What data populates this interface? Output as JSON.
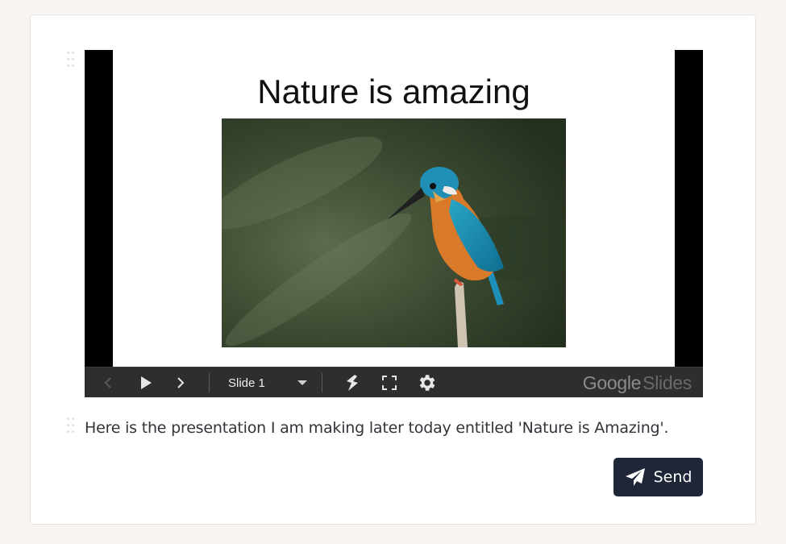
{
  "slide": {
    "title": "Nature is amazing",
    "image_description": "kingfisher-photo"
  },
  "controls": {
    "slide_selector": "Slide 1",
    "brand_google": "Google",
    "brand_slides": "Slides"
  },
  "icons": {
    "prev": "chevron-left-icon",
    "play": "play-icon",
    "next": "chevron-right-icon",
    "laser": "laser-pointer-icon",
    "fullscreen": "fullscreen-icon",
    "settings": "gear-icon",
    "send": "paper-plane-icon"
  },
  "caption": "Here is the presentation I am making later today entitled 'Nature is Amazing'.",
  "send_button": {
    "label": "Send"
  },
  "colors": {
    "page_bg": "#f8f4f1",
    "button_bg": "#1f2637",
    "controls_bg": "#2e2e2e"
  }
}
